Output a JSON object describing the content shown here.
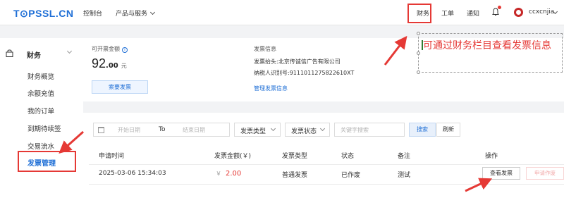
{
  "header": {
    "logo": "T⊙PSSL.CN",
    "nav": {
      "console": "控制台",
      "products": "产品与服务"
    },
    "right": {
      "finance": "财务",
      "ticket": "工单",
      "notice": "通知",
      "username": "ccxcnjia"
    }
  },
  "sidebar": {
    "section_title": "财务",
    "items": [
      {
        "label": "财务概览"
      },
      {
        "label": "余额充值"
      },
      {
        "label": "我的订单"
      },
      {
        "label": "到期待续签"
      },
      {
        "label": "交易流水"
      },
      {
        "label": "发票管理"
      }
    ]
  },
  "summary": {
    "amount_label": "可开票金额",
    "amount_int": "92",
    "amount_dec": ".00",
    "amount_unit": "元",
    "request_button": "索要发票",
    "info_title": "发票信息",
    "info_header": "发票抬头:北京传诚信广告有限公司",
    "info_taxid": "纳税人识别号:911101127582261​0XT",
    "manage_link": "管理发票信息"
  },
  "annotation": {
    "text": "可通过财务栏目查看发票信息"
  },
  "filters": {
    "start_placeholder": "开始日期",
    "to": "To",
    "end_placeholder": "结束日期",
    "type_select": "发票类型",
    "status_select": "发票状态",
    "keyword_placeholder": "关键字搜索",
    "search_button": "搜索",
    "reset_button": "刷新"
  },
  "table": {
    "columns": [
      "申请时间",
      "发票金额(￥)",
      "发票类型",
      "状态",
      "备注",
      "操作"
    ],
    "rows": [
      {
        "time": "2025-03-06 15:34:03",
        "currency": "￥",
        "amount": "2.00",
        "type": "普通发票",
        "status": "已作废",
        "note": "测试",
        "view_button": "查看发票",
        "void_button": "申请作废"
      }
    ]
  },
  "colors": {
    "accent": "#1f6fd6",
    "annotation": "#e53935"
  },
  "icons": [
    "chevron-down-icon",
    "bell-icon",
    "avatar",
    "lock-icon",
    "info-icon",
    "calendar-icon",
    "arrow-annotation"
  ]
}
